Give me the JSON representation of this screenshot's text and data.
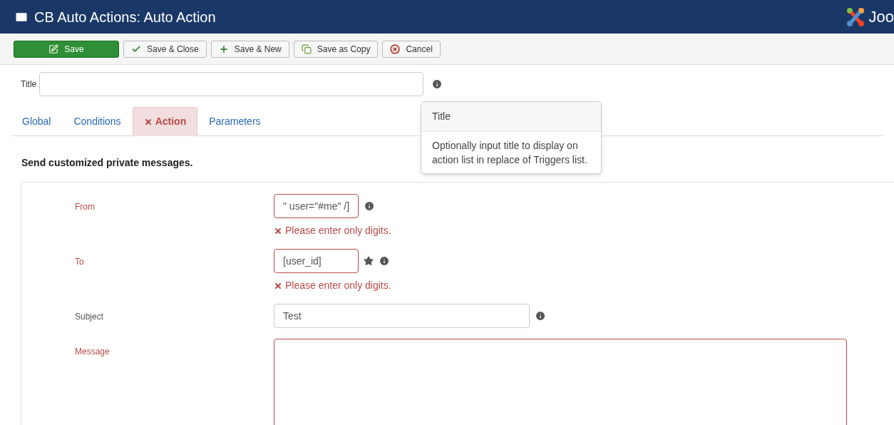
{
  "header": {
    "title": "CB Auto Actions: Auto Action",
    "brand": "Joo"
  },
  "toolbar": [
    {
      "label": "Save",
      "kind": "primary"
    },
    {
      "label": "Save & Close",
      "kind": "default"
    },
    {
      "label": "Save & New",
      "kind": "default"
    },
    {
      "label": "Save as Copy",
      "kind": "default"
    },
    {
      "label": "Cancel",
      "kind": "default"
    }
  ],
  "title_field": {
    "label": "Title"
  },
  "tooltip": {
    "title": "Title",
    "text": "Optionally input title to display on action list in replace of Triggers list."
  },
  "tabs": [
    {
      "label": "Global",
      "selected": false,
      "invalid": false
    },
    {
      "label": "Conditions",
      "selected": false,
      "invalid": false
    },
    {
      "label": "Action",
      "selected": true,
      "invalid": true
    },
    {
      "label": "Parameters",
      "selected": false,
      "invalid": false
    }
  ],
  "description": "Send customized private messages.",
  "fields": [
    {
      "label": "From",
      "kind": "short",
      "value": "\" user=\"#me\" /]",
      "invalid": true,
      "error": "Please enter only digits.",
      "starred": false,
      "info": true
    },
    {
      "label": "To",
      "kind": "short",
      "value": "[user_id]",
      "invalid": true,
      "error": "Please enter only digits.",
      "starred": true,
      "info": true
    },
    {
      "label": "Subject",
      "kind": "text",
      "value": "Test",
      "invalid": false,
      "starred": false,
      "info": true
    },
    {
      "label": "Message",
      "kind": "textarea",
      "invalid": true,
      "starred": false,
      "info": false
    }
  ]
}
